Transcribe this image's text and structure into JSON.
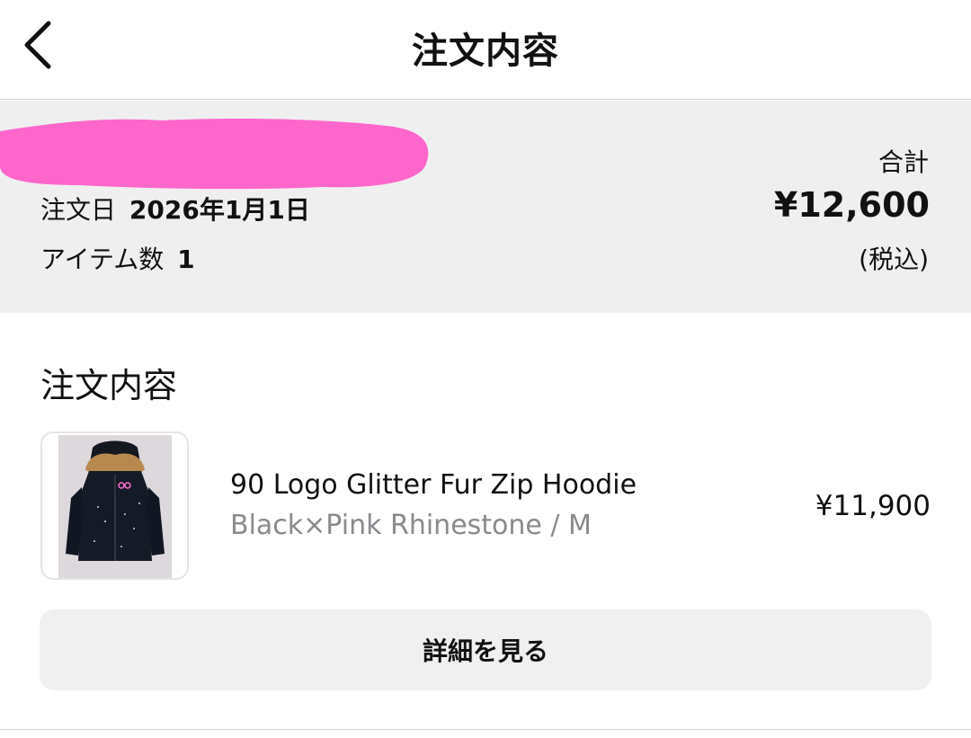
{
  "header": {
    "title": "注文内容",
    "back_icon": "chevron-left-icon"
  },
  "summary": {
    "redaction_color": "#ff66cc",
    "order_date_label": "注文日",
    "order_date_value": "2026年1月1日",
    "item_count_label": "アイテム数",
    "item_count_value": "1",
    "total_label": "合計",
    "total_amount": "¥12,600",
    "tax_note": "(税込)"
  },
  "order": {
    "section_title": "注文内容",
    "items": [
      {
        "name": "90 Logo Glitter Fur Zip Hoodie",
        "variant": "Black×Pink Rhinestone / M",
        "price": "¥11,900",
        "thumbnail_icon": "hoodie-image"
      }
    ],
    "detail_button_label": "詳細を見る"
  }
}
